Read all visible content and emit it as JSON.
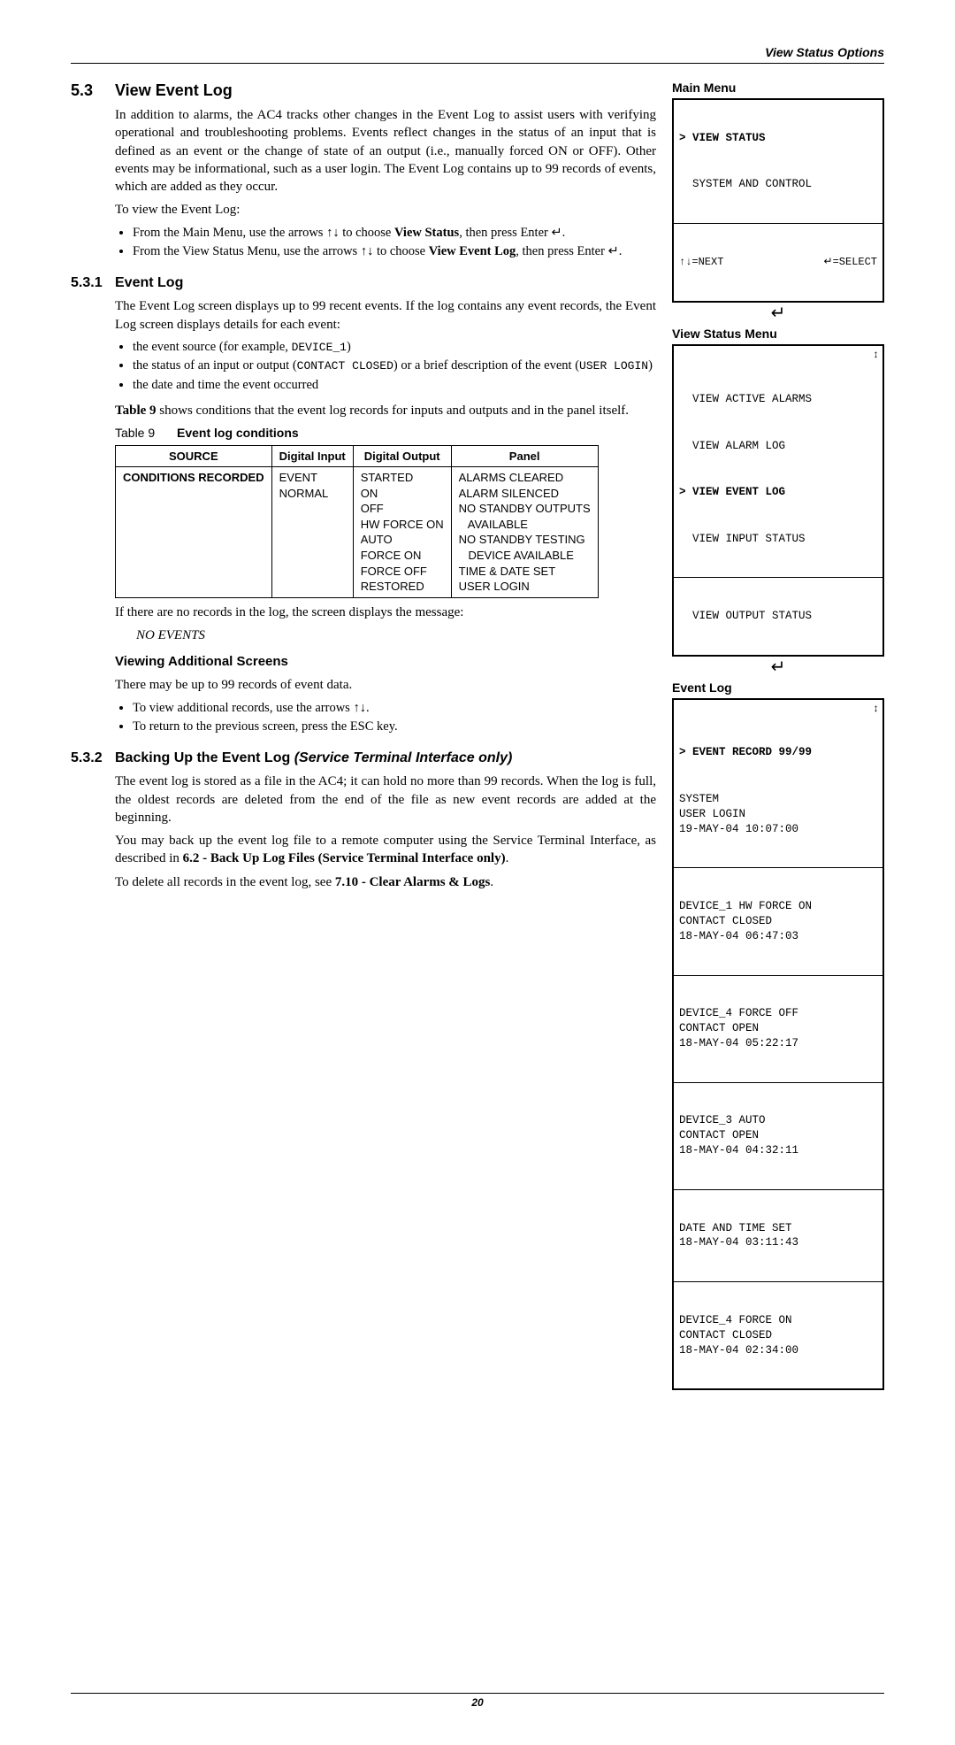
{
  "header": {
    "running": "View Status Options"
  },
  "footer": {
    "page": "20"
  },
  "sec53": {
    "num": "5.3",
    "title": "View Event Log",
    "p1_a": "In addition to alarms, the AC4 tracks other changes in the Event Log to assist users with verifying operational and troubleshooting problems. Events reflect changes in the status of an input that is defined as an event or the change of state of an output (i.e., manually forced ON or OFF). Other events may be informational, such as a user login. The Event Log contains up to 99 records of events, which are added as they occur.",
    "p2": "To view the Event Log:",
    "li1_a": "From the Main Menu, use the arrows ↑↓ to choose ",
    "li1_b": "View Status",
    "li1_c": ", then press Enter ↵.",
    "li2_a": "From the View Status Menu, use the arrows ↑↓ to choose ",
    "li2_b": "View Event Log",
    "li2_c": ", then press Enter ↵."
  },
  "sec531": {
    "num": "5.3.1",
    "title": "Event Log",
    "p1": "The Event Log screen displays up to 99 recent events. If the log contains any event records, the Event Log screen displays details for each event:",
    "li1_a": "the event source (for example, ",
    "li1_b": "DEVICE_1",
    "li1_c": ")",
    "li2_a": "the status of an input or output (",
    "li2_b": "CONTACT CLOSED",
    "li2_c": ") or a brief description of the event (",
    "li2_d": "USER LOGIN",
    "li2_e": ")",
    "li3": "the date and time the event occurred",
    "p2_a": "Table 9",
    "p2_b": " shows conditions that the event log records for inputs and outputs and in the panel itself.",
    "tablecap_lbl": "Table 9",
    "tablecap_title": "Event log conditions",
    "p3": "If there are no records in the log, the screen displays the message:",
    "noevents": "NO EVENTS",
    "vastitle": "Viewing Additional Screens",
    "vas_p": "There may be up to 99 records of event data.",
    "vas_li1": "To view additional records, use the arrows ↑↓.",
    "vas_li2": "To return to the previous screen, press the ESC key."
  },
  "table9": {
    "headers": [
      "SOURCE",
      "Digital Input",
      "Digital Output",
      "Panel"
    ],
    "rowlabel": "CONDITIONS RECORDED",
    "digital_input": "EVENT\nNORMAL",
    "digital_output": "STARTED\nON\nOFF\nHW FORCE ON\nAUTO\nFORCE ON\nFORCE OFF\nRESTORED",
    "panel": "ALARMS CLEARED\nALARM SILENCED\nNO STANDBY OUTPUTS\n   AVAILABLE\nNO STANDBY TESTING\n   DEVICE AVAILABLE\nTIME & DATE SET\nUSER LOGIN"
  },
  "sec532": {
    "num": "5.3.2",
    "title_a": "Backing Up the Event Log ",
    "title_b": "(Service Terminal Interface only)",
    "p1": "The event log is stored as a file in the AC4; it can hold no more than 99 records. When the log is full, the oldest records are deleted from the end of the file as new event records are added at the beginning.",
    "p2_a": "You may back up the event log file to a remote computer using the Service Terminal Interface, as described in ",
    "p2_b": "6.2 - Back Up Log Files (Service Terminal Interface only)",
    "p2_c": ".",
    "p3_a": "To delete all records in the event log, see ",
    "p3_b": "7.10 - Clear Alarms & Logs",
    "p3_c": "."
  },
  "lcd": {
    "main_title": "Main Menu",
    "main_line1": "> VIEW STATUS",
    "main_line2": "  SYSTEM AND CONTROL",
    "main_nav_left": "↑↓=NEXT",
    "main_nav_right": "↵=SELECT",
    "vs_title": "View Status Menu",
    "vs_l1": "  VIEW ACTIVE ALARMS",
    "vs_l2": "  VIEW ALARM LOG",
    "vs_l3": "> VIEW EVENT LOG",
    "vs_l4": "  VIEW INPUT STATUS",
    "vs_l5": "  VIEW OUTPUT STATUS",
    "el_title": "Event Log",
    "el_head": "> EVENT RECORD 99/99",
    "records": [
      "SYSTEM\nUSER LOGIN\n19-MAY-04 10:07:00",
      "DEVICE_1 HW FORCE ON\nCONTACT CLOSED\n18-MAY-04 06:47:03",
      "DEVICE_4 FORCE OFF\nCONTACT OPEN\n18-MAY-04 05:22:17",
      "DEVICE_3 AUTO\nCONTACT OPEN\n18-MAY-04 04:32:11",
      "DATE AND TIME SET\n18-MAY-04 03:11:43",
      "DEVICE_4 FORCE ON\nCONTACT CLOSED\n18-MAY-04 02:34:00"
    ]
  }
}
